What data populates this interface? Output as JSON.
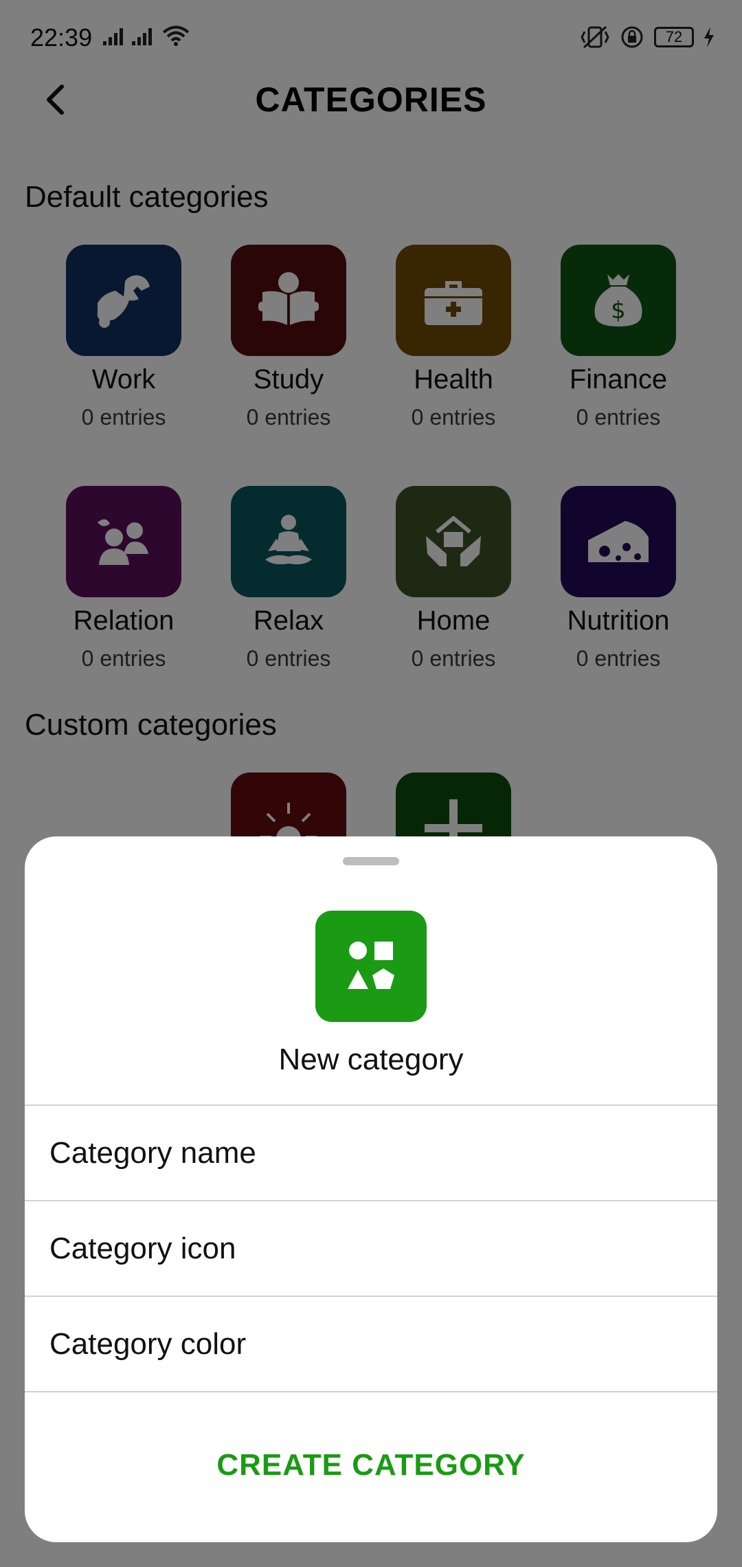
{
  "status_bar": {
    "time": "22:39",
    "battery": "72"
  },
  "header": {
    "title": "CATEGORIES"
  },
  "default_section": {
    "title": "Default categories",
    "items": [
      {
        "name": "Work",
        "count": "0 entries",
        "color": "#103163",
        "icon": "wrench-hand-icon"
      },
      {
        "name": "Study",
        "count": "0 entries",
        "color": "#560d0d",
        "icon": "reading-person-icon"
      },
      {
        "name": "Health",
        "count": "0 entries",
        "color": "#714c04",
        "icon": "medical-kit-icon"
      },
      {
        "name": "Finance",
        "count": "0 entries",
        "color": "#0f5613",
        "icon": "money-bag-icon"
      },
      {
        "name": "Relation",
        "count": "0 entries",
        "color": "#5a0f5c",
        "icon": "people-icon"
      },
      {
        "name": "Relax",
        "count": "0 entries",
        "color": "#09565a",
        "icon": "meditation-icon"
      },
      {
        "name": "Home",
        "count": "0 entries",
        "color": "#3d5226",
        "icon": "house-hands-icon"
      },
      {
        "name": "Nutrition",
        "count": "0 entries",
        "color": "#240b5a",
        "icon": "cheese-icon"
      }
    ]
  },
  "custom_section": {
    "title": "Custom categories",
    "items": [
      {
        "color": "#640d0d",
        "icon": "sun-icon"
      },
      {
        "color": "#0b4f0c",
        "icon": "plus-icon"
      }
    ]
  },
  "sheet": {
    "title": "New category",
    "icon": "shapes-icon",
    "accent": "#1a9b13",
    "fields": [
      "Category name",
      "Category icon",
      "Category color"
    ],
    "create_label": "CREATE CATEGORY"
  }
}
